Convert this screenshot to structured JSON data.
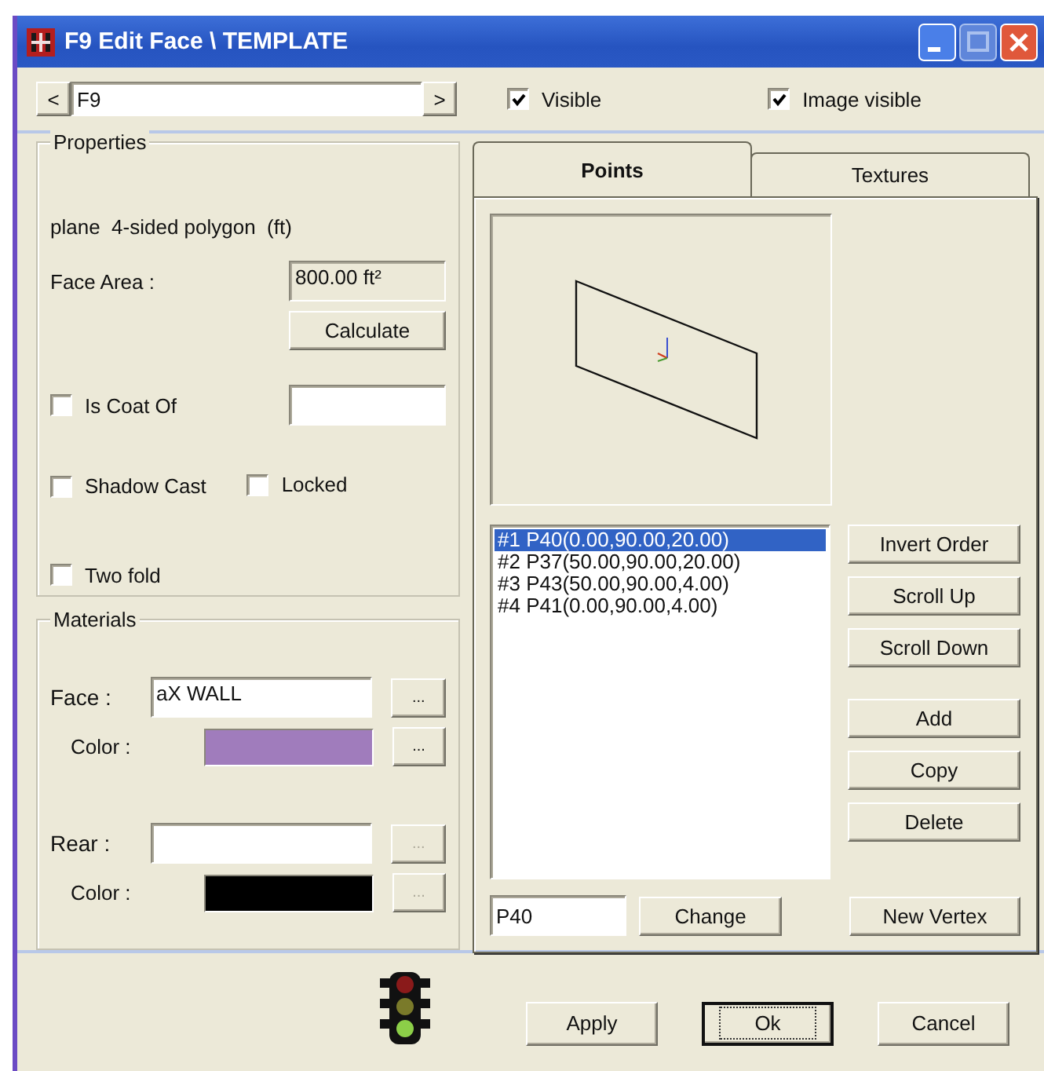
{
  "window": {
    "title": "F9 Edit Face \\ TEMPLATE"
  },
  "navigator": {
    "prev": "<",
    "value": "F9",
    "next": ">"
  },
  "visible": {
    "label": "Visible",
    "checked": true
  },
  "image_visible": {
    "label": "Image visible",
    "checked": true
  },
  "properties": {
    "title": "Properties",
    "description": "plane  4-sided polygon  (ft)",
    "area_label": "Face Area :",
    "area_value": "800.00 ft²",
    "calculate": "Calculate",
    "is_coat_of": {
      "label": "Is Coat Of",
      "checked": false
    },
    "shadow_cast": {
      "label": "Shadow Cast",
      "checked": false
    },
    "locked": {
      "label": "Locked",
      "checked": false
    },
    "two_fold": {
      "label": "Two fold",
      "checked": false
    }
  },
  "materials": {
    "title": "Materials",
    "slots": [
      {
        "label": "Face :",
        "value": "aX WALL",
        "color_label": "Color :",
        "color": "#a07cbc",
        "browse": "...",
        "color_browse": "...",
        "disabled": false
      },
      {
        "label": "Rear :",
        "color_label": "Color :",
        "color": "#000000",
        "browse": "...",
        "color_browse": "...",
        "disabled": true
      }
    ]
  },
  "tabs": [
    {
      "label": "Points",
      "selected": true
    },
    {
      "label": "Textures",
      "selected": false
    }
  ],
  "points": [
    {
      "text": "#1  P40(0.00,90.00,20.00)",
      "selected": true
    },
    {
      "text": "#2  P37(50.00,90.00,20.00)",
      "selected": false
    },
    {
      "text": "#3  P43(50.00,90.00,4.00)",
      "selected": false
    },
    {
      "text": "#4  P41(0.00,90.00,4.00)",
      "selected": false
    }
  ],
  "point_buttons": [
    [
      "Invert Order",
      "Scroll Up",
      "Scroll Down"
    ],
    [
      "Add",
      "Copy",
      "Delete"
    ]
  ],
  "vertex": {
    "value": "P40",
    "change": "Change",
    "new_vertex": "New Vertex"
  },
  "footer_buttons": [
    {
      "label": "Apply",
      "default": false
    },
    {
      "label": "Ok",
      "default": true
    },
    {
      "label": "Cancel",
      "default": false
    }
  ]
}
